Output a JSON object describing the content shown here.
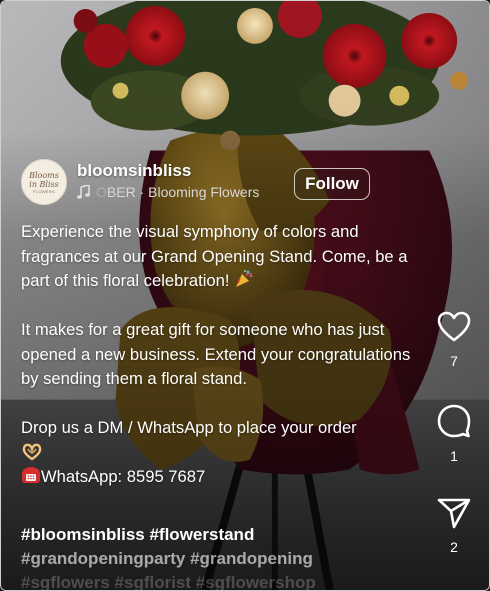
{
  "post": {
    "username": "bloomsinbliss",
    "audio_faded": "OBER",
    "audio_label": "BER · Blooming Flowers",
    "follow_label": "Follow",
    "avatar_logo": "Blooms in Bliss",
    "caption": {
      "para1": "Experience the visual symphony of colors and fragrances at our Grand Opening Stand. Come, be a part of this floral celebration!",
      "para2": "It makes for a great gift for someone who has just opened a new business. Extend your congratulations by sending them a floral stand.",
      "para3": "Drop us a DM / WhatsApp to place your order",
      "whatsapp": "WhatsApp: 8595 7687"
    },
    "hashtags": {
      "line1": "#bloomsinbliss #flowerstand",
      "line2": "#grandopeningparty #grandopening",
      "line3": "#sgflowers #sgflorist #sgflowershop"
    }
  },
  "actions": {
    "like": {
      "icon": "heart-icon",
      "count": "7"
    },
    "comment": {
      "icon": "comment-icon",
      "count": "1"
    },
    "share": {
      "icon": "send-icon",
      "count": "2"
    }
  },
  "colors": {
    "text": "#ffffff",
    "subtext": "#d8d8d8",
    "ribbon_gold": "#8a6a1e",
    "ribbon_burgundy": "#4a0f1c",
    "flower_red": "#b3121c"
  }
}
